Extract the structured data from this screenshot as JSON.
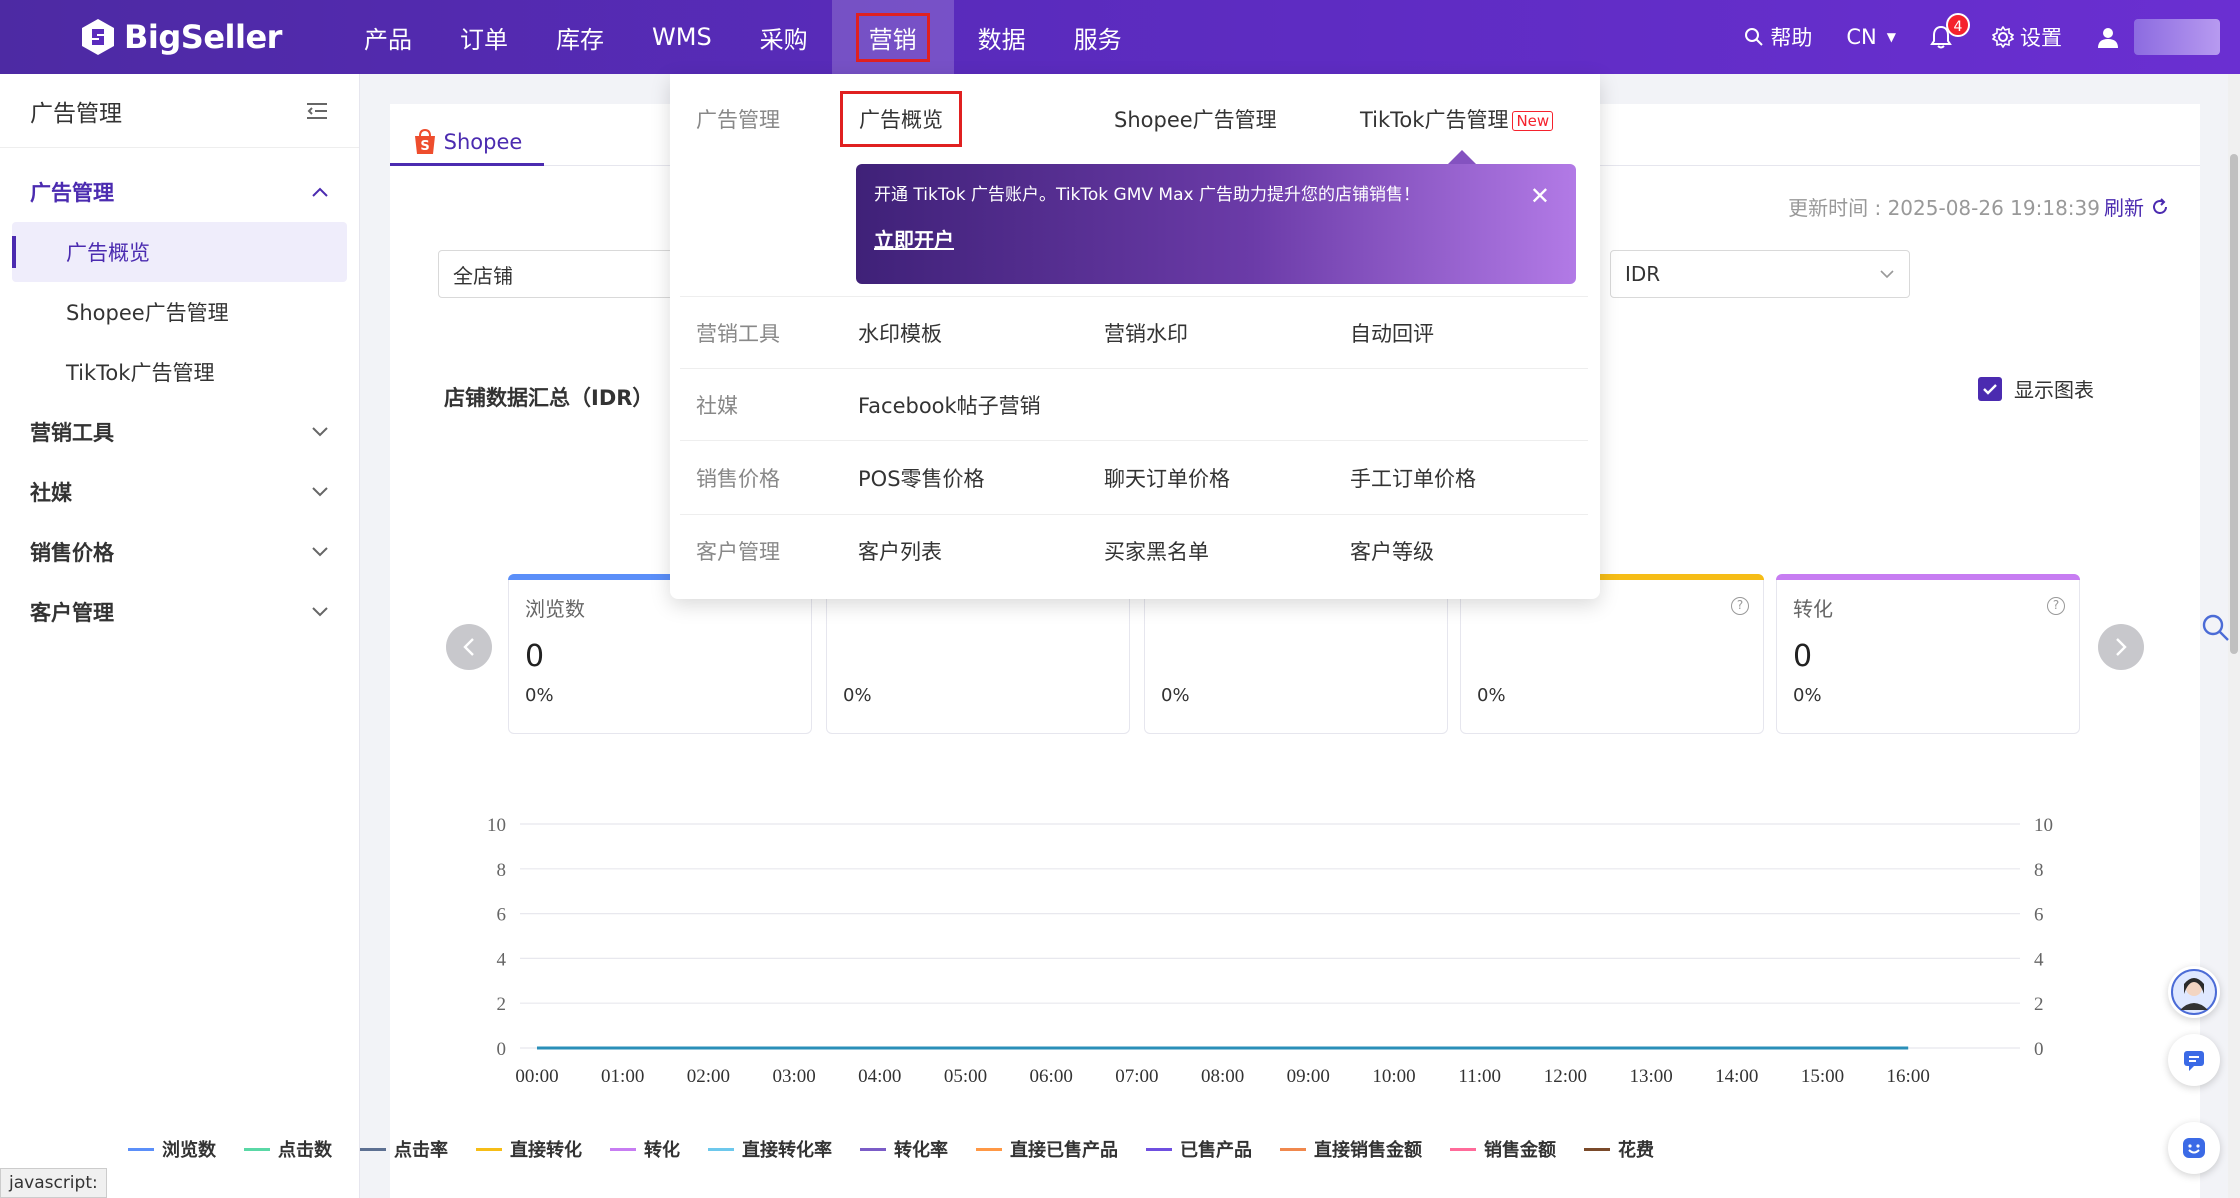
{
  "brand": "BigSeller",
  "nav": [
    "产品",
    "订单",
    "库存",
    "WMS",
    "采购",
    "营销",
    "数据",
    "服务"
  ],
  "topright": {
    "help": "帮助",
    "lang": "CN",
    "notifications": "4",
    "settings": "设置"
  },
  "sidebar": {
    "title": "广告管理",
    "groups": [
      {
        "label": "广告管理",
        "items": [
          "广告概览",
          "Shopee广告管理",
          "TikTok广告管理"
        ]
      },
      {
        "label": "营销工具"
      },
      {
        "label": "社媒"
      },
      {
        "label": "销售价格"
      },
      {
        "label": "客户管理"
      }
    ]
  },
  "main": {
    "tab": "Shopee",
    "update_time": "更新时间 : 2025-08-26 19:18:39",
    "refresh": "刷新",
    "store_select": "全店铺",
    "currency_select": "IDR",
    "section_title": "店铺数据汇总（IDR）",
    "show_chart": "显示图表",
    "cards": [
      {
        "label": "浏览数",
        "value": "0",
        "pct": "0%",
        "color": "#5b8ff9"
      },
      {
        "label": "",
        "value": "",
        "pct": "0%",
        "color": "#5ad8a6"
      },
      {
        "label": "",
        "value": "",
        "pct": "0%",
        "color": "#5d7092"
      },
      {
        "label": "",
        "value": "",
        "pct": "0%",
        "color": "#f6bd16"
      },
      {
        "label": "转化",
        "value": "0",
        "pct": "0%",
        "color": "#c77df2"
      }
    ]
  },
  "chart_data": {
    "type": "line",
    "x": [
      "00:00",
      "01:00",
      "02:00",
      "03:00",
      "04:00",
      "05:00",
      "06:00",
      "07:00",
      "08:00",
      "09:00",
      "10:00",
      "11:00",
      "12:00",
      "13:00",
      "14:00",
      "15:00",
      "16:00"
    ],
    "ylim": [
      0,
      10
    ],
    "yticks": [
      "0",
      "2",
      "4",
      "6",
      "8",
      "10"
    ],
    "series": [
      {
        "name": "浏览数",
        "values": [
          0,
          0,
          0,
          0,
          0,
          0,
          0,
          0,
          0,
          0,
          0,
          0,
          0,
          0,
          0,
          0,
          0
        ],
        "color": "#5b8ff9"
      }
    ],
    "legend": [
      {
        "name": "浏览数",
        "color": "#5b8ff9"
      },
      {
        "name": "点击数",
        "color": "#5ad8a6"
      },
      {
        "name": "点击率",
        "color": "#5d7092"
      },
      {
        "name": "直接转化",
        "color": "#f6bd16"
      },
      {
        "name": "转化",
        "color": "#c77df2"
      },
      {
        "name": "直接转化率",
        "color": "#6dc8ec"
      },
      {
        "name": "转化率",
        "color": "#7b5cc7"
      },
      {
        "name": "直接已售产品",
        "color": "#ff9845"
      },
      {
        "name": "已售产品",
        "color": "#6f4fe0"
      },
      {
        "name": "直接销售金额",
        "color": "#f0884d"
      },
      {
        "name": "销售金额",
        "color": "#ff6b9a"
      },
      {
        "name": "花费",
        "color": "#7a4a2a"
      }
    ]
  },
  "dropdown": {
    "rows": [
      {
        "category": "广告管理",
        "links": [
          "广告概览",
          "Shopee广告管理",
          "TikTok广告管理"
        ],
        "new_badge": "New"
      },
      {
        "category": "营销工具",
        "links": [
          "水印模板",
          "营销水印",
          "自动回评"
        ]
      },
      {
        "category": "社媒",
        "links": [
          "Facebook帖子营销"
        ]
      },
      {
        "category": "销售价格",
        "links": [
          "POS零售价格",
          "聊天订单价格",
          "手工订单价格"
        ]
      },
      {
        "category": "客户管理",
        "links": [
          "客户列表",
          "买家黑名单",
          "客户等级"
        ]
      }
    ],
    "promo": {
      "text": "开通 TikTok 广告账户。TikTok GMV Max 广告助力提升您的店铺销售！",
      "cta": "立即开户"
    }
  },
  "status_tip": "javascript:"
}
